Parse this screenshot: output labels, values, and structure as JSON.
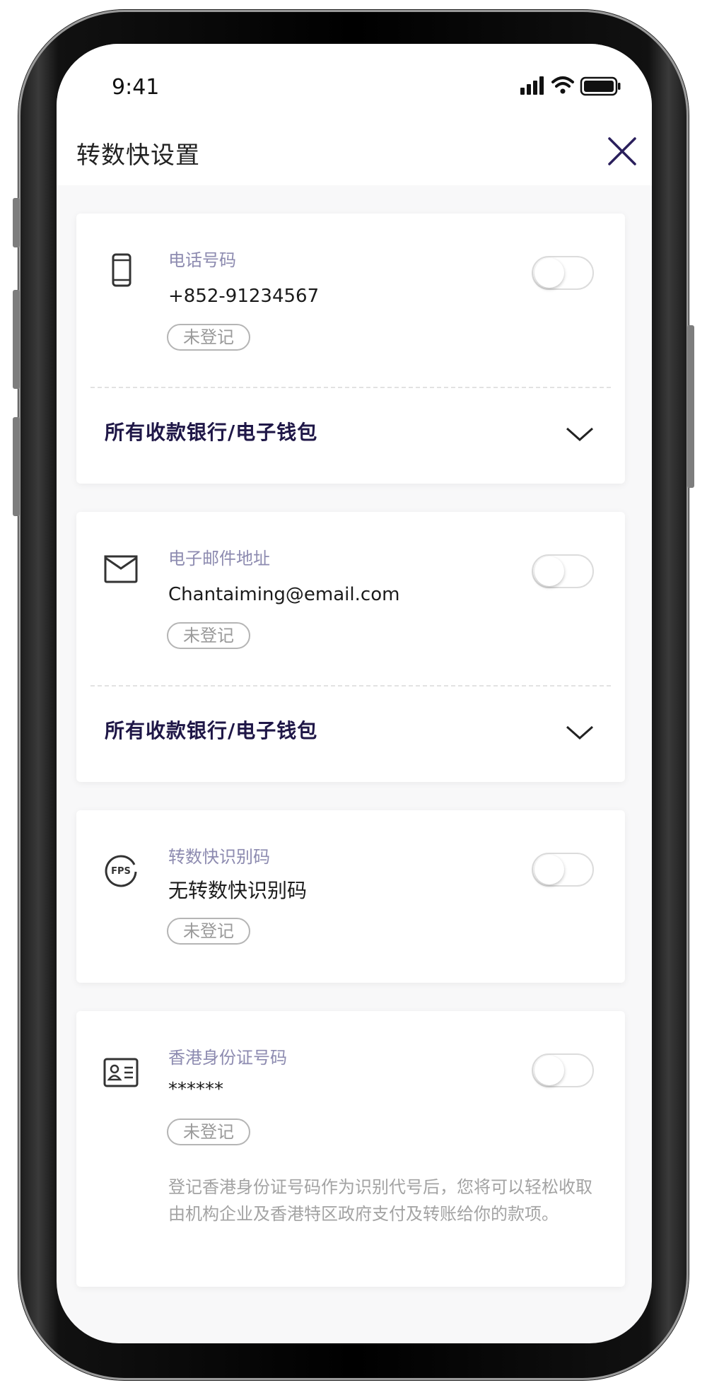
{
  "status_bar": {
    "time": "9:41"
  },
  "header": {
    "title": "转数快设置"
  },
  "cards": [
    {
      "label": "电话号码",
      "value": "+852-91234567",
      "badge": "未登记",
      "bank": "所有收款银行/电子钱包",
      "icon": "phone-icon"
    },
    {
      "label": "电子邮件地址",
      "value": "Chantaiming@email.com",
      "badge": "未登记",
      "bank": "所有收款银行/电子钱包",
      "icon": "mail-icon"
    },
    {
      "label": "转数快识别码",
      "value": "无转数快识别码",
      "badge": "未登记",
      "icon": "fps-icon"
    },
    {
      "label": "香港身份证号码",
      "value": "******",
      "badge": "未登记",
      "icon": "id-card-icon",
      "note": "登记香港身份证号码作为识别代号后，您将可以轻松收取由机构企业及香港特区政府支付及转账给你的款项。"
    }
  ],
  "colors": {
    "label": "#8d8bb0",
    "bank_text": "#1f1747",
    "accent_dark": "#2a1f5c"
  }
}
